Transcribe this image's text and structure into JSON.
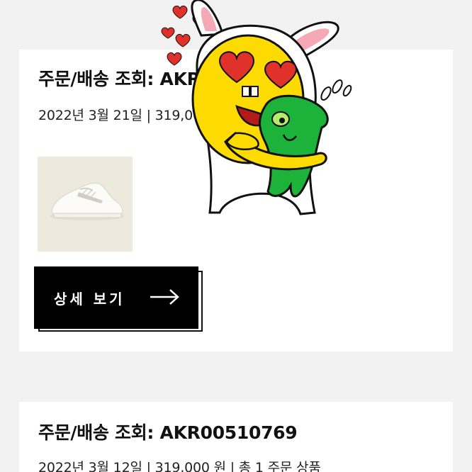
{
  "orders": [
    {
      "title": "주문/배송 조회: AKR00510770",
      "meta": "2022년 3월 21일 | 319,000 원 | 총 1 주문 상품",
      "button_label": "상세 보기"
    },
    {
      "title": "주문/배송 조회: AKR00510769",
      "meta": "2022년 3월 12일 | 319,000 원 | 총 1 주문 상품"
    }
  ],
  "icons": {
    "arrow": "arrow-right-icon",
    "sticker": "kakao-emoticon-sticker",
    "product": "sneaker-thumbnail"
  },
  "colors": {
    "background": "#f2f2f2",
    "card": "#ffffff",
    "button": "#000000"
  }
}
